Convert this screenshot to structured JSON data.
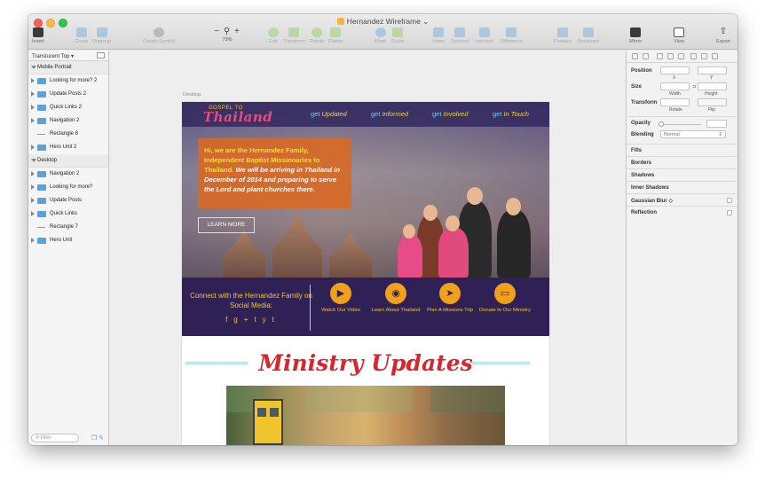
{
  "window": {
    "title": "Hernandez Wireframe"
  },
  "toolbar": {
    "insert": "Insert",
    "group": "Group",
    "ungroup": "Ungroup",
    "create_symbol": "Create Symbol",
    "zoom": "73%",
    "zoom_minus": "−",
    "zoom_plus": "+",
    "edit": "Edit",
    "transform": "Transform",
    "rotate": "Rotate",
    "flatten": "Flatten",
    "mask": "Mask",
    "scale": "Scale",
    "union": "Union",
    "subtract": "Subtract",
    "intersect": "Intersect",
    "difference": "Difference",
    "forward": "Forward",
    "backward": "Backward",
    "mirror": "Mirror",
    "view": "View",
    "export": "Export"
  },
  "layers": {
    "page_name": "Translucent Top",
    "items": [
      {
        "label": "Mobile Portrait",
        "kind": "group-head"
      },
      {
        "label": "Looking for more? 2",
        "kind": "folder"
      },
      {
        "label": "Update Posts 2",
        "kind": "folder"
      },
      {
        "label": "Quick Links 2",
        "kind": "folder"
      },
      {
        "label": "Navigation 2",
        "kind": "folder"
      },
      {
        "label": "Rectangle 8",
        "kind": "rect"
      },
      {
        "label": "Hero Unit 2",
        "kind": "folder"
      },
      {
        "label": "Desktop",
        "kind": "group-head"
      },
      {
        "label": "Navigation 2",
        "kind": "folder"
      },
      {
        "label": "Looking for more?",
        "kind": "folder"
      },
      {
        "label": "Update Posts",
        "kind": "folder"
      },
      {
        "label": "Quick Links",
        "kind": "folder"
      },
      {
        "label": "Rectangle 7",
        "kind": "rect"
      },
      {
        "label": "Hero Unit",
        "kind": "folder"
      }
    ],
    "filter_placeholder": "Filter"
  },
  "canvas": {
    "artboard_label": "Desktop",
    "site": {
      "logo_top": "GOSPEL TO",
      "logo_main": "Thailand",
      "nav": [
        {
          "pre": "get",
          "word": "Updated"
        },
        {
          "pre": "get",
          "word": "Informed"
        },
        {
          "pre": "get",
          "word": "Involved"
        },
        {
          "pre": "get",
          "word": "In Touch"
        }
      ],
      "callout_yellow": "Hi, we are the Hernandez Family, Independent Baptist Missionaries to Thailand.",
      "callout_white": "We will be arriving in Thailand in December of 2014 and preparing to serve the Lord and plant churches there.",
      "learn_more": "LEARN MORE",
      "connect_text": "Connect with the Hernandez Family on Social Media:",
      "social_icons": [
        "f",
        "g+",
        "t",
        "yt"
      ],
      "ctas": [
        {
          "label": "Watch Our Video",
          "icon": "play-icon",
          "glyph": "▶"
        },
        {
          "label": "Learn About Thailand",
          "icon": "globe-icon",
          "glyph": "◉"
        },
        {
          "label": "Plan A Missions Trip",
          "icon": "paper-plane-icon",
          "glyph": "➤"
        },
        {
          "label": "Donate to Our Ministry",
          "icon": "credit-card-icon",
          "glyph": "▭"
        }
      ],
      "updates_title": "Ministry Updates"
    }
  },
  "inspector": {
    "position": "Position",
    "x": "X",
    "y": "Y",
    "size": "Size",
    "width": "Width",
    "height": "Height",
    "transform": "Transform",
    "rotate": "Rotate",
    "flip": "Flip",
    "opacity": "Opacity",
    "blending": "Blending",
    "blending_value": "Normal",
    "sections": [
      "Fills",
      "Borders",
      "Shadows",
      "Inner Shadows",
      "Gaussian Blur ◇",
      "Reflection"
    ]
  }
}
